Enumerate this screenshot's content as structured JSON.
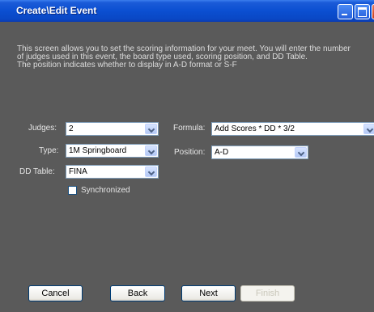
{
  "window": {
    "title": "Create\\Edit Event"
  },
  "description": {
    "lines": [
      "This screen allows you to set the scoring information for your meet. You will enter the number",
      "of judges used in this event, the board type used, scoring position, and DD Table.",
      "The position indicates whether to display in A-D format or S-F"
    ]
  },
  "form": {
    "judges": {
      "label": "Judges:",
      "value": "2"
    },
    "type": {
      "label": "Type:",
      "value": "1M Springboard"
    },
    "dd_table": {
      "label": "DD Table:",
      "value": "FINA"
    },
    "synchronized": {
      "label": "Synchronized",
      "checked": false
    },
    "formula": {
      "label": "Formula:",
      "value": "Add Scores * DD * 3/2"
    },
    "position": {
      "label": "Position:",
      "value": "A-D"
    }
  },
  "buttons": {
    "cancel": "Cancel",
    "back": "Back",
    "next": "Next",
    "finish": "Finish"
  },
  "colors": {
    "window_background": "#5a5a5a",
    "titlebar": "#0b4fd1"
  }
}
